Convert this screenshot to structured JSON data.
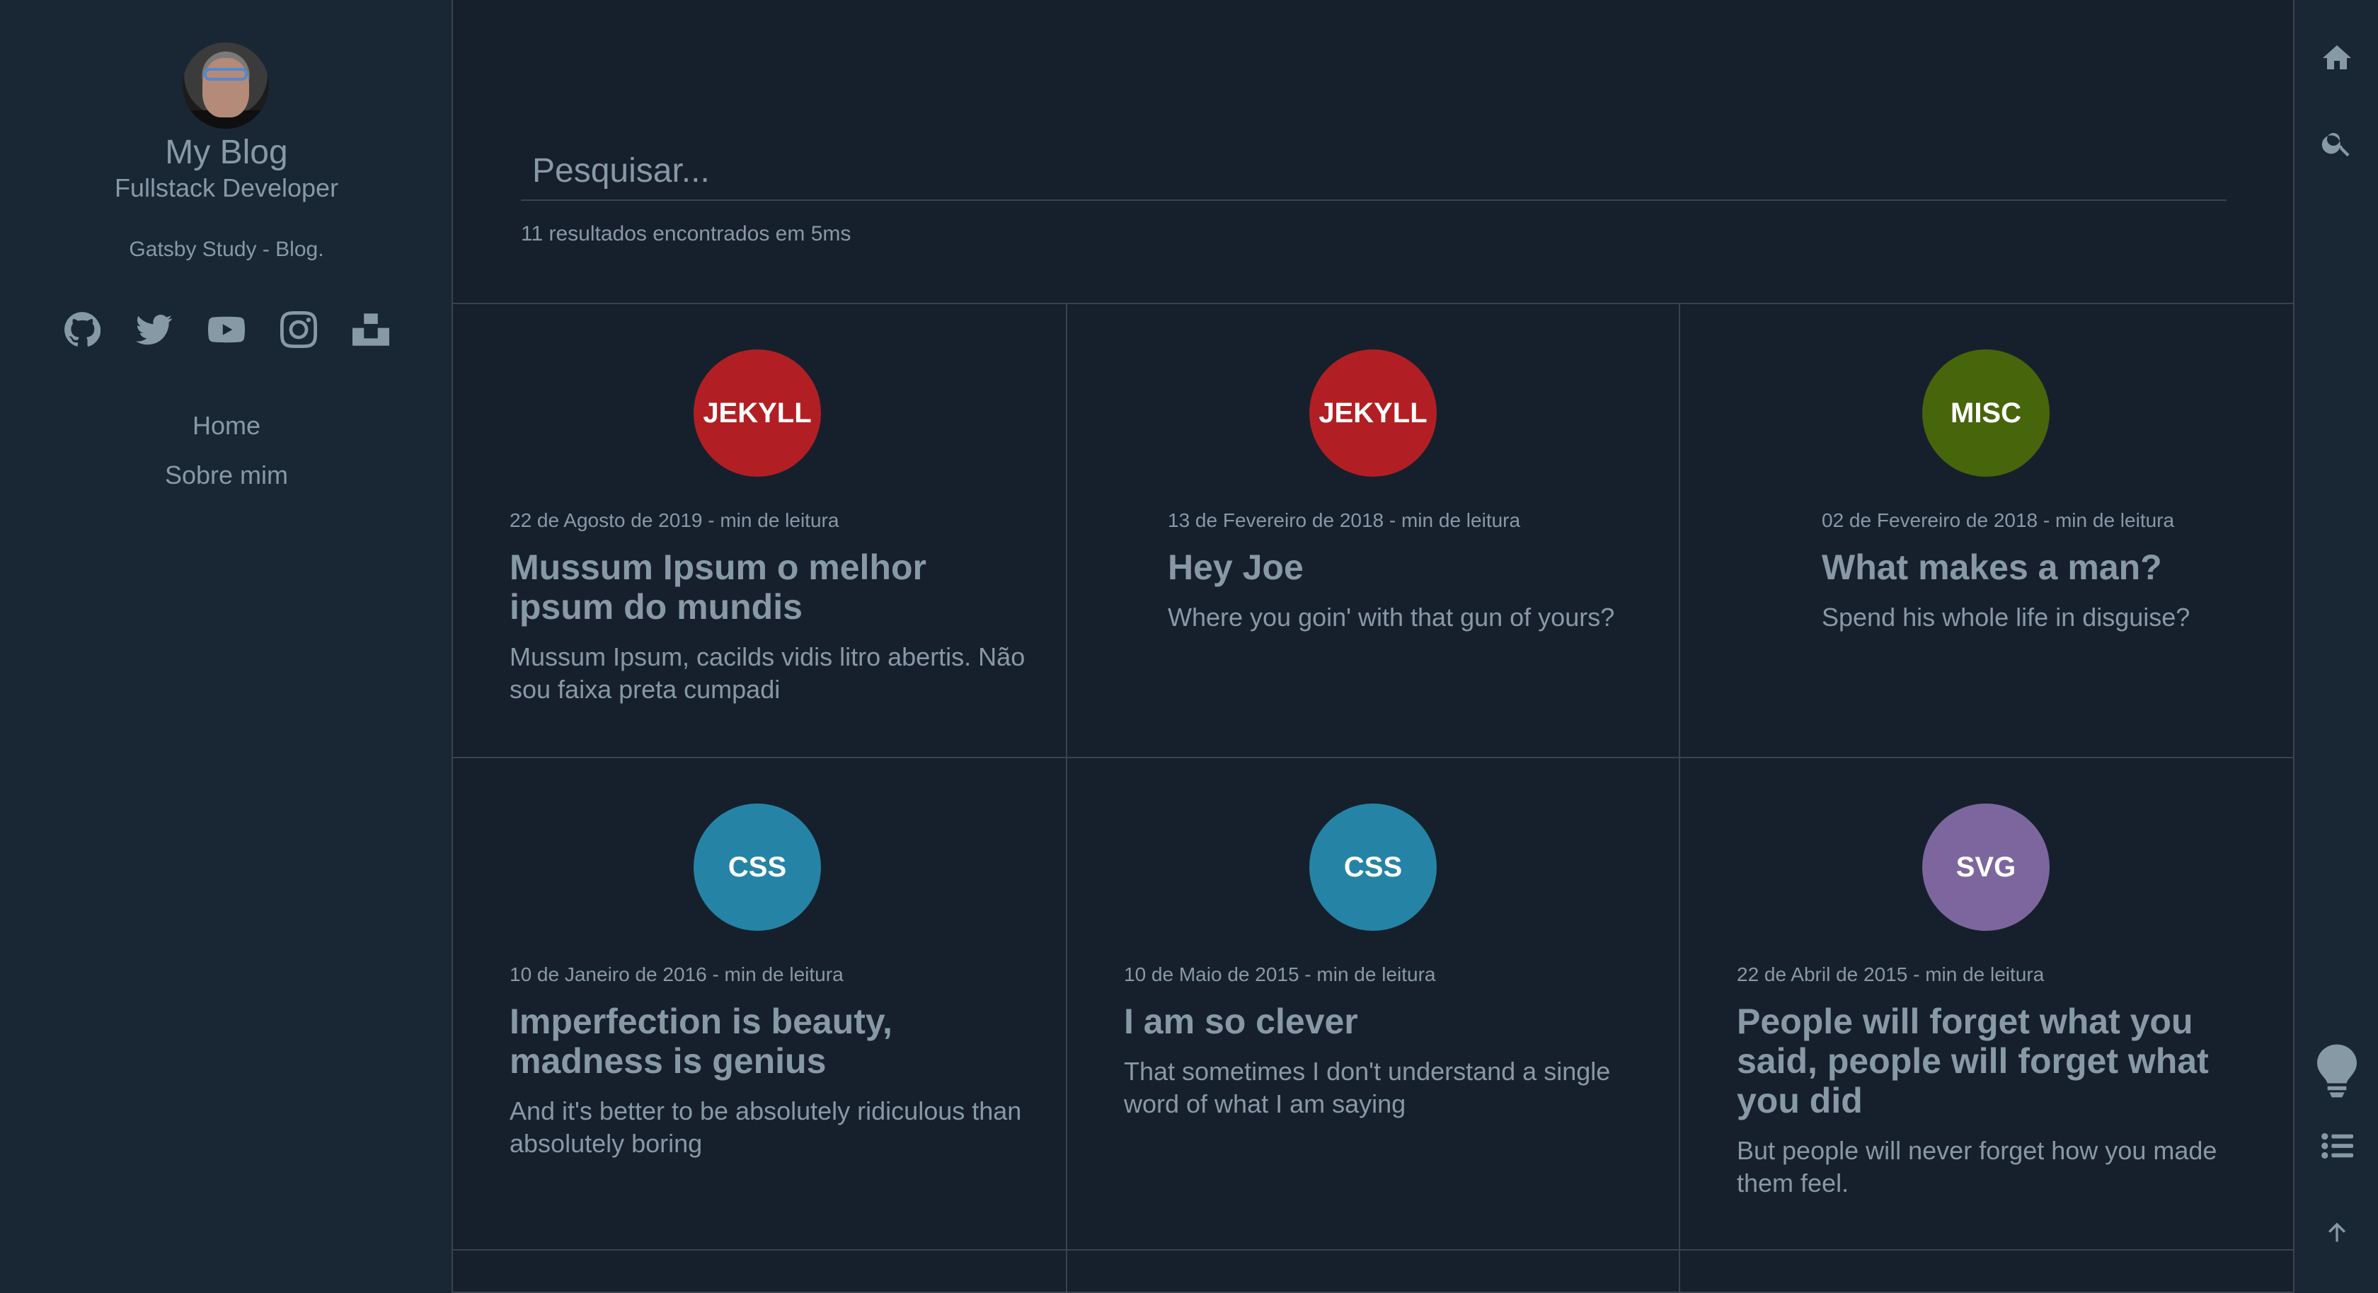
{
  "sidebar": {
    "title": "My Blog",
    "position": "Fullstack Developer",
    "description": "Gatsby Study - Blog.",
    "social": [
      "github-icon",
      "twitter-icon",
      "youtube-icon",
      "instagram-icon",
      "unsplash-icon"
    ],
    "menu": [
      "Home",
      "Sobre mim"
    ]
  },
  "search": {
    "placeholder": "Pesquisar...",
    "stats": "11 resultados encontrados em 5ms"
  },
  "posts": [
    {
      "tag": "JEKYLL",
      "tag_color": "#b11f24",
      "meta": "22 de Agosto de 2019 - min de leitura",
      "title": "Mussum Ipsum o melhor ipsum do mundis",
      "excerpt": "Mussum Ipsum, cacilds vidis litro abertis. Não sou faixa preta cumpadi"
    },
    {
      "tag": "JEKYLL",
      "tag_color": "#b11f24",
      "meta": "13 de Fevereiro de 2018 - min de leitura",
      "title": "Hey Joe",
      "excerpt": "Where you goin' with that gun of yours?"
    },
    {
      "tag": "MISC",
      "tag_color": "#47650b",
      "meta": "02 de Fevereiro de 2018 - min de leitura",
      "title": "What makes a man?",
      "excerpt": "Spend his whole life in disguise?"
    },
    {
      "tag": "CSS",
      "tag_color": "#2584a6",
      "meta": "10 de Janeiro de 2016 - min de leitura",
      "title": "Imperfection is beauty, madness is genius",
      "excerpt": "And it's better to be absolutely ridiculous than absolutely boring"
    },
    {
      "tag": "CSS",
      "tag_color": "#2584a6",
      "meta": "10 de Maio de 2015 - min de leitura",
      "title": "I am so clever",
      "excerpt": "That sometimes I don't understand a single word of what I am saying"
    },
    {
      "tag": "SVG",
      "tag_color": "#7d669e",
      "meta": "22 de Abril de 2015 - min de leitura",
      "title": "People will forget what you said, people will forget what you did",
      "excerpt": "But people will never forget how you made them feel."
    }
  ],
  "rightbar": [
    "home-icon",
    "search-icon",
    "lightbulb-icon",
    "list-icon",
    "arrow-up-icon"
  ]
}
